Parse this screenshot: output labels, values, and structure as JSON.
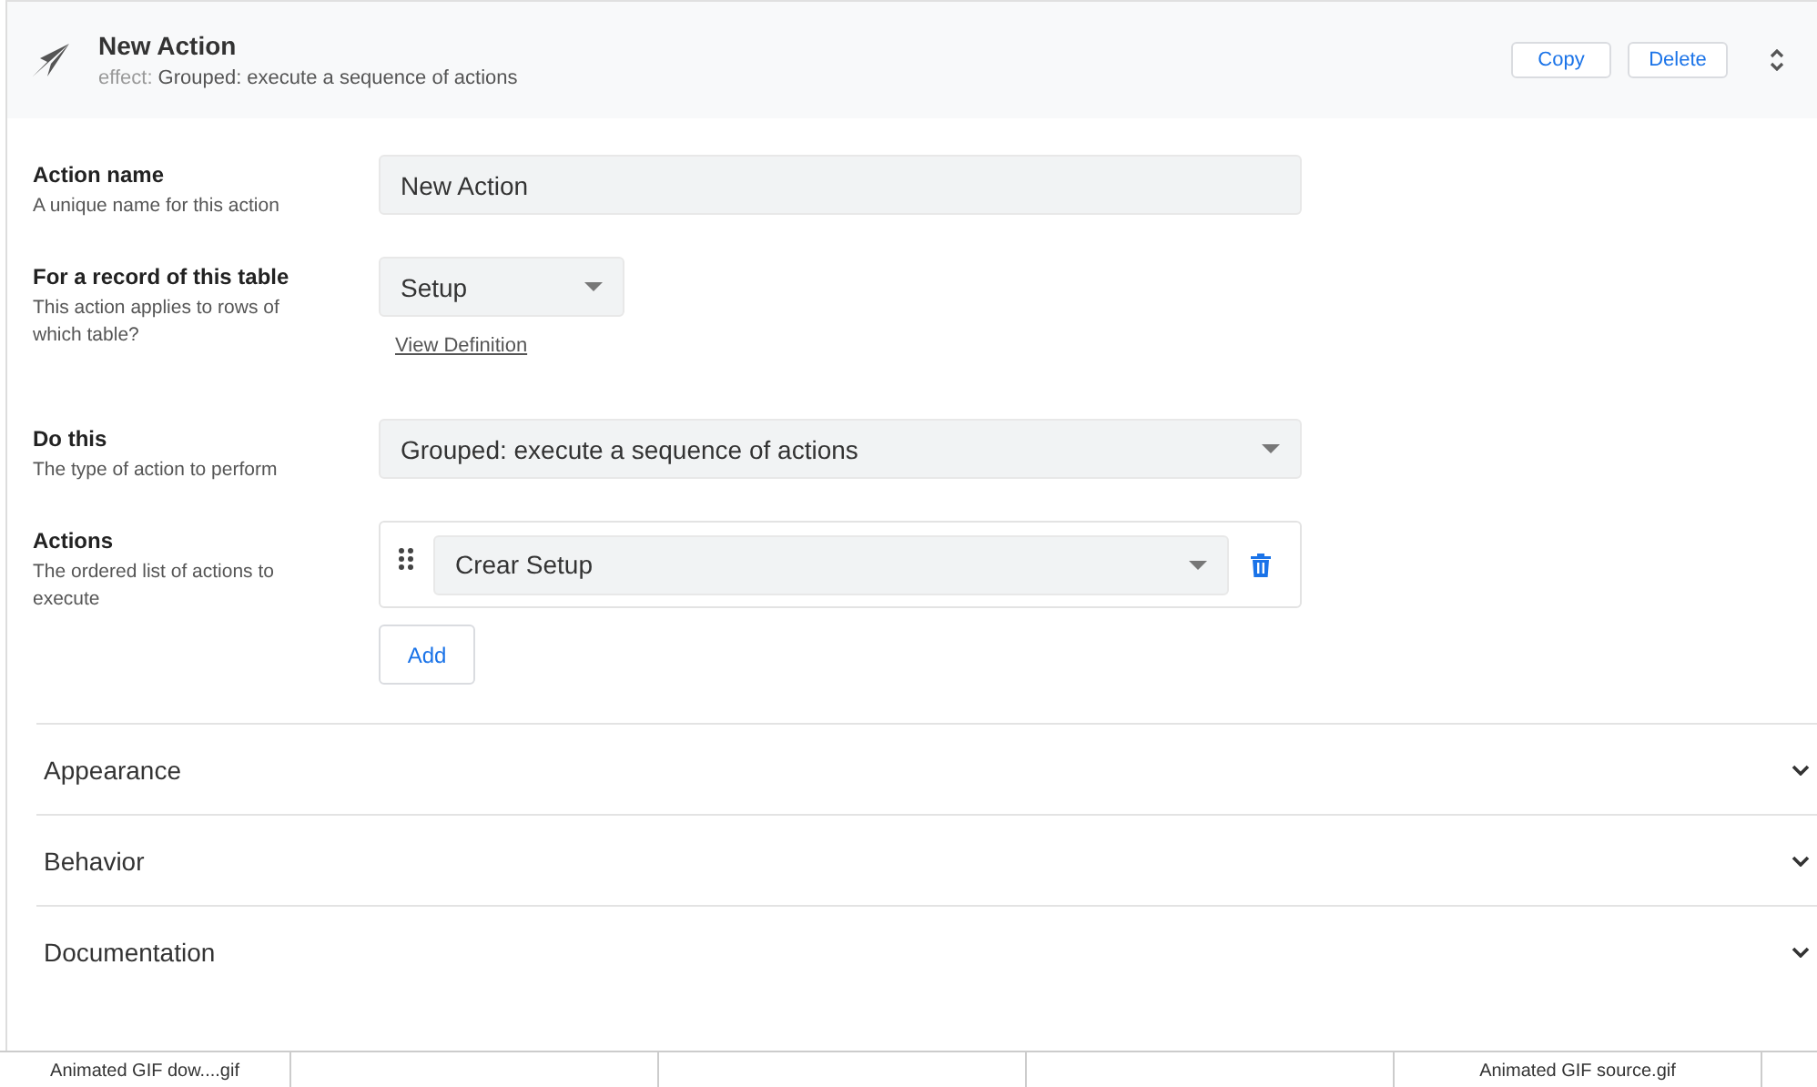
{
  "header": {
    "title": "New Action",
    "effect_label": "effect:",
    "effect": "Grouped: execute a sequence of actions",
    "buttons": [
      "Copy",
      "Delete"
    ]
  },
  "fields": [
    {
      "kind": "text",
      "label": "Action name",
      "hint": "A unique name for this action",
      "value": "New Action"
    },
    {
      "kind": "select-short",
      "label": "For a record of this table",
      "hint": "This action applies to rows of which table?",
      "value": "Setup",
      "link": "View Definition"
    },
    {
      "kind": "select",
      "label": "Do this",
      "hint": "The type of action to perform",
      "value": "Grouped: execute a sequence of actions"
    },
    {
      "kind": "list",
      "label": "Actions",
      "hint": "The ordered list of actions to execute",
      "items": [
        "Crear Setup"
      ],
      "add": "Add"
    }
  ],
  "sections": [
    {
      "label": "Appearance",
      "expanded": false
    },
    {
      "label": "Behavior",
      "expanded": false
    },
    {
      "label": "Documentation",
      "expanded": false
    }
  ],
  "files": [
    {
      "name": "Animated GIF dow....gif"
    },
    {
      "name": "Animated GIF source.gif"
    }
  ]
}
